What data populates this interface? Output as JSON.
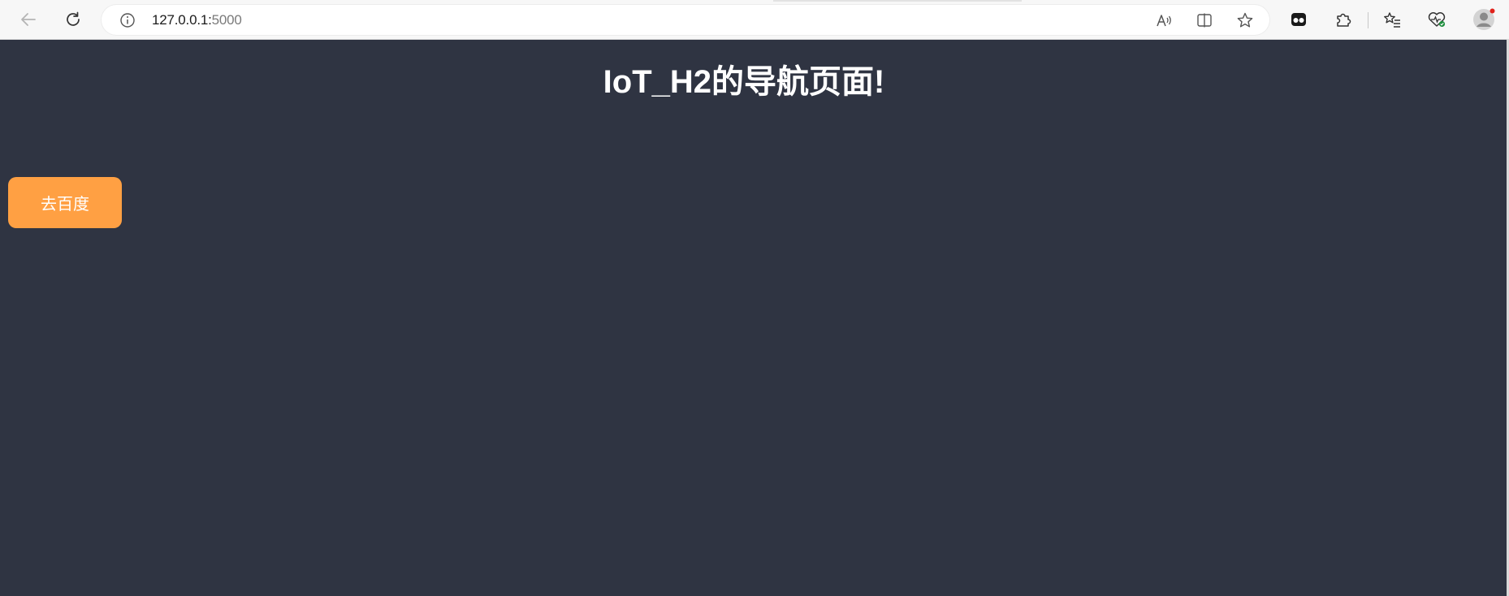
{
  "browser": {
    "url_host": "127.0.0.1:",
    "url_port": "5000",
    "icons": {
      "back": "back-arrow-icon",
      "reload": "reload-icon",
      "info": "info-icon",
      "read_aloud": "read-aloud-icon",
      "split_screen": "split-screen-icon",
      "favorite": "star-icon",
      "extension_app": "extension-app-icon",
      "extensions": "puzzle-icon",
      "favorites_list": "favorites-list-icon",
      "health": "browser-essentials-icon",
      "profile": "profile-avatar-icon"
    }
  },
  "page": {
    "title": "IoT_H2的导航页面!",
    "button_label": "去百度",
    "colors": {
      "background": "#2f3442",
      "button": "#ffa043",
      "text": "#ffffff"
    }
  }
}
